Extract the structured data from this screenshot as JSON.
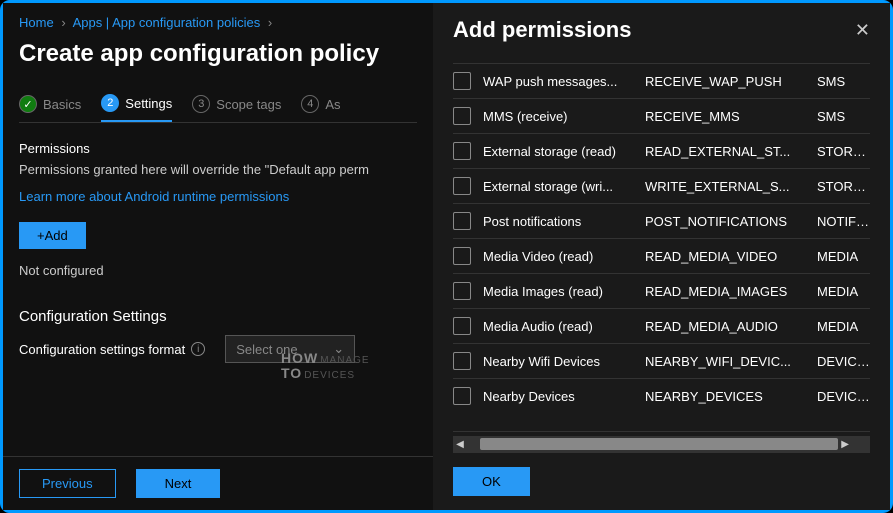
{
  "breadcrumb": {
    "home": "Home",
    "apps": "Apps | App configuration policies"
  },
  "pageTitle": "Create app configuration policy",
  "tabs": {
    "basics": "Basics",
    "settings": "Settings",
    "scopeTags": "Scope tags",
    "assignments": "As"
  },
  "permissions": {
    "heading": "Permissions",
    "helper": "Permissions granted here will override the \"Default app perm",
    "learnMore": "Learn more about Android runtime permissions",
    "addLabel": "+Add",
    "notConfigured": "Not configured"
  },
  "configSettings": {
    "heading": "Configuration Settings",
    "formatLabel": "Configuration settings format",
    "selectPlaceholder": "Select one"
  },
  "footer": {
    "previous": "Previous",
    "next": "Next"
  },
  "panel": {
    "title": "Add permissions",
    "ok": "OK",
    "rows": [
      {
        "name": "WAP push messages...",
        "code": "RECEIVE_WAP_PUSH",
        "group": "SMS"
      },
      {
        "name": "MMS (receive)",
        "code": "RECEIVE_MMS",
        "group": "SMS"
      },
      {
        "name": "External storage (read)",
        "code": "READ_EXTERNAL_ST...",
        "group": "STORAGE"
      },
      {
        "name": "External storage (wri...",
        "code": "WRITE_EXTERNAL_S...",
        "group": "STORAGE"
      },
      {
        "name": "Post notifications",
        "code": "POST_NOTIFICATIONS",
        "group": "NOTIFICATI"
      },
      {
        "name": "Media Video (read)",
        "code": "READ_MEDIA_VIDEO",
        "group": "MEDIA"
      },
      {
        "name": "Media Images (read)",
        "code": "READ_MEDIA_IMAGES",
        "group": "MEDIA"
      },
      {
        "name": "Media Audio (read)",
        "code": "READ_MEDIA_AUDIO",
        "group": "MEDIA"
      },
      {
        "name": "Nearby Wifi Devices",
        "code": "NEARBY_WIFI_DEVIC...",
        "group": "DEVICES"
      },
      {
        "name": "Nearby Devices",
        "code": "NEARBY_DEVICES",
        "group": "DEVICES"
      }
    ]
  }
}
